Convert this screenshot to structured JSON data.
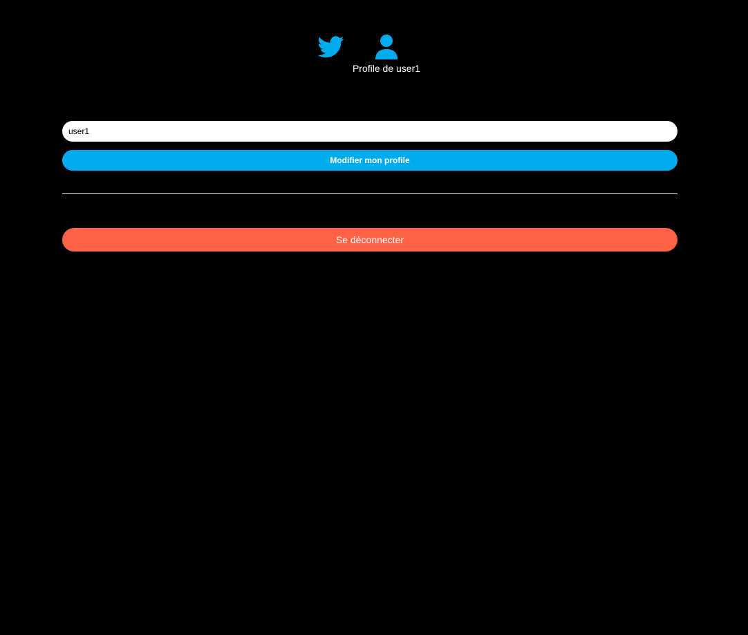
{
  "header": {
    "twitter_icon": "twitter-bird-icon",
    "profile_icon": "user-icon",
    "profile_caption": "Profile de user1"
  },
  "profile_form": {
    "username_value": "user1",
    "modify_button_label": "Modifier mon profile"
  },
  "logout": {
    "button_label": "Se déconnecter"
  },
  "colors": {
    "background": "#000000",
    "accent": "#00aced",
    "danger": "#ff6347",
    "text": "#ffffff"
  }
}
